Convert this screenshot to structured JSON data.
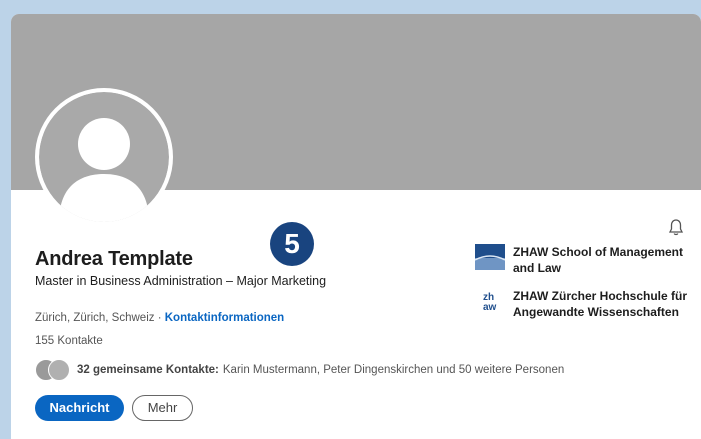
{
  "profile": {
    "name": "Andrea Template",
    "headline": "Master in Business Administration – Major Marketing",
    "location": "Zürich, Zürich, Schweiz ·",
    "contact_info_link": "Kontaktinformationen",
    "connections": "155 Kontakte",
    "mutual_label": "32 gemeinsame Kontakte:",
    "mutual_names": "Karin Mustermann, Peter Dingenskirchen und 50 weitere Personen"
  },
  "step_marker": "5",
  "actions": {
    "message": "Nachricht",
    "more": "Mehr"
  },
  "education": [
    {
      "name": "ZHAW School of Management and Law",
      "logo_icon": "school-logo-icon"
    },
    {
      "name": "ZHAW Zürcher Hochschule für Angewandte Wissenschaften",
      "logo_icon": "zhaw-logo-icon"
    }
  ],
  "colors": {
    "background": "#bcd3e8",
    "banner": "#a6a6a6",
    "primary": "#0a66c2",
    "step_marker": "#19447f"
  },
  "icons": {
    "notification": "bell-icon",
    "avatar": "avatar-placeholder-icon"
  }
}
